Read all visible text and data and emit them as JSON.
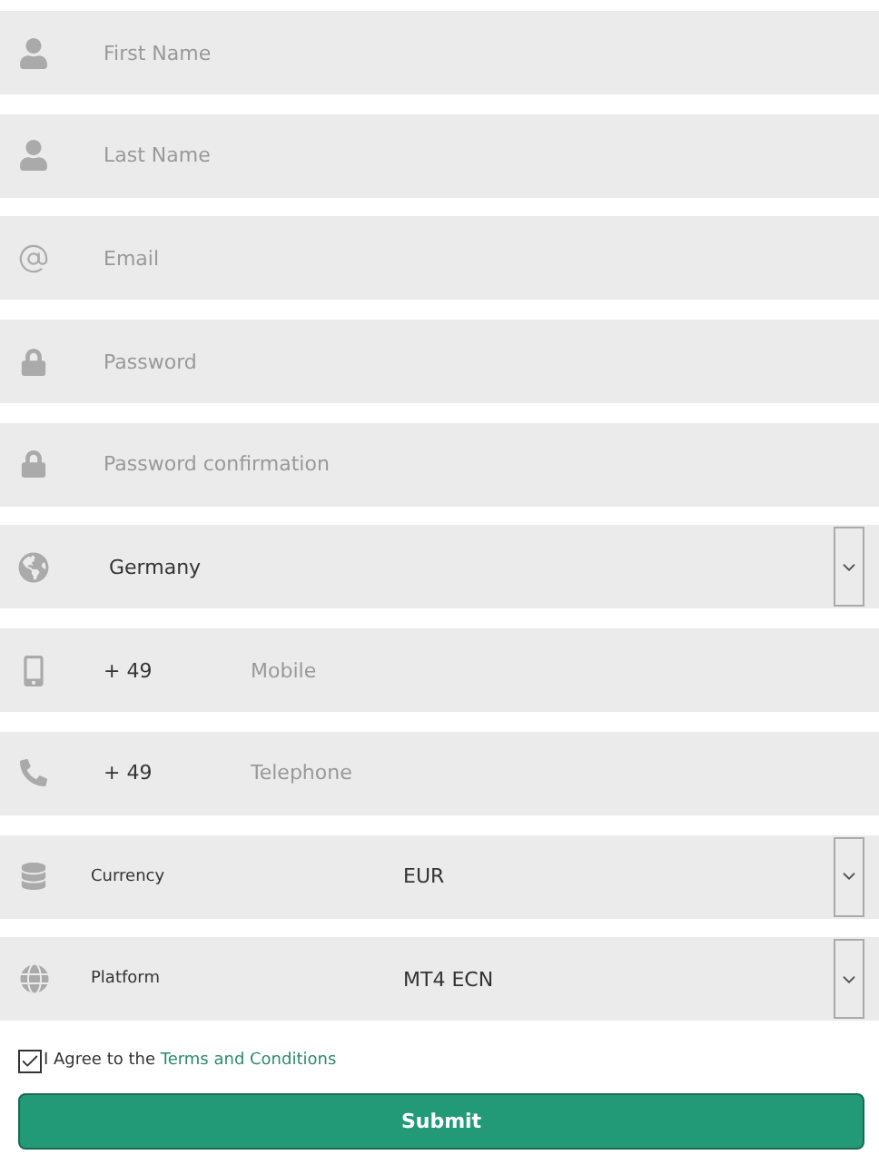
{
  "fields": [
    {
      "kind": "text",
      "placeholder": "First Name"
    },
    {
      "kind": "text",
      "placeholder": "Last Name"
    },
    {
      "kind": "text",
      "placeholder": "Email"
    },
    {
      "kind": "text",
      "placeholder": "Password"
    },
    {
      "kind": "text",
      "placeholder": "Password confirmation"
    },
    {
      "kind": "select",
      "value": "Germany"
    },
    {
      "kind": "phone",
      "code": "+ 49",
      "placeholder": "Mobile"
    },
    {
      "kind": "phone",
      "code": "+ 49",
      "placeholder": "Telephone"
    },
    {
      "kind": "labeled_select",
      "label": "Currency",
      "value": "EUR"
    },
    {
      "kind": "labeled_select",
      "label": "Platform",
      "value": "MT4 ECN"
    }
  ],
  "agree": {
    "checked": true,
    "text": "I Agree to the ",
    "link": "Terms and Conditions"
  },
  "submit": "Submit"
}
